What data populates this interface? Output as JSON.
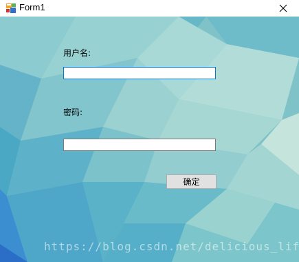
{
  "window": {
    "title": "Form1",
    "app_icon": "winforms-app-icon",
    "close_icon": "close-icon"
  },
  "form": {
    "username_label": "用户名:",
    "username_value": "",
    "password_label": "密码:",
    "password_value": "",
    "ok_button": "确定"
  },
  "watermark": "https://blog.csdn.net/delicious_life",
  "colors": {
    "background_teal": "#7fc3c9",
    "input_focus_border": "#0078d7",
    "button_face": "#e1e1e1"
  }
}
